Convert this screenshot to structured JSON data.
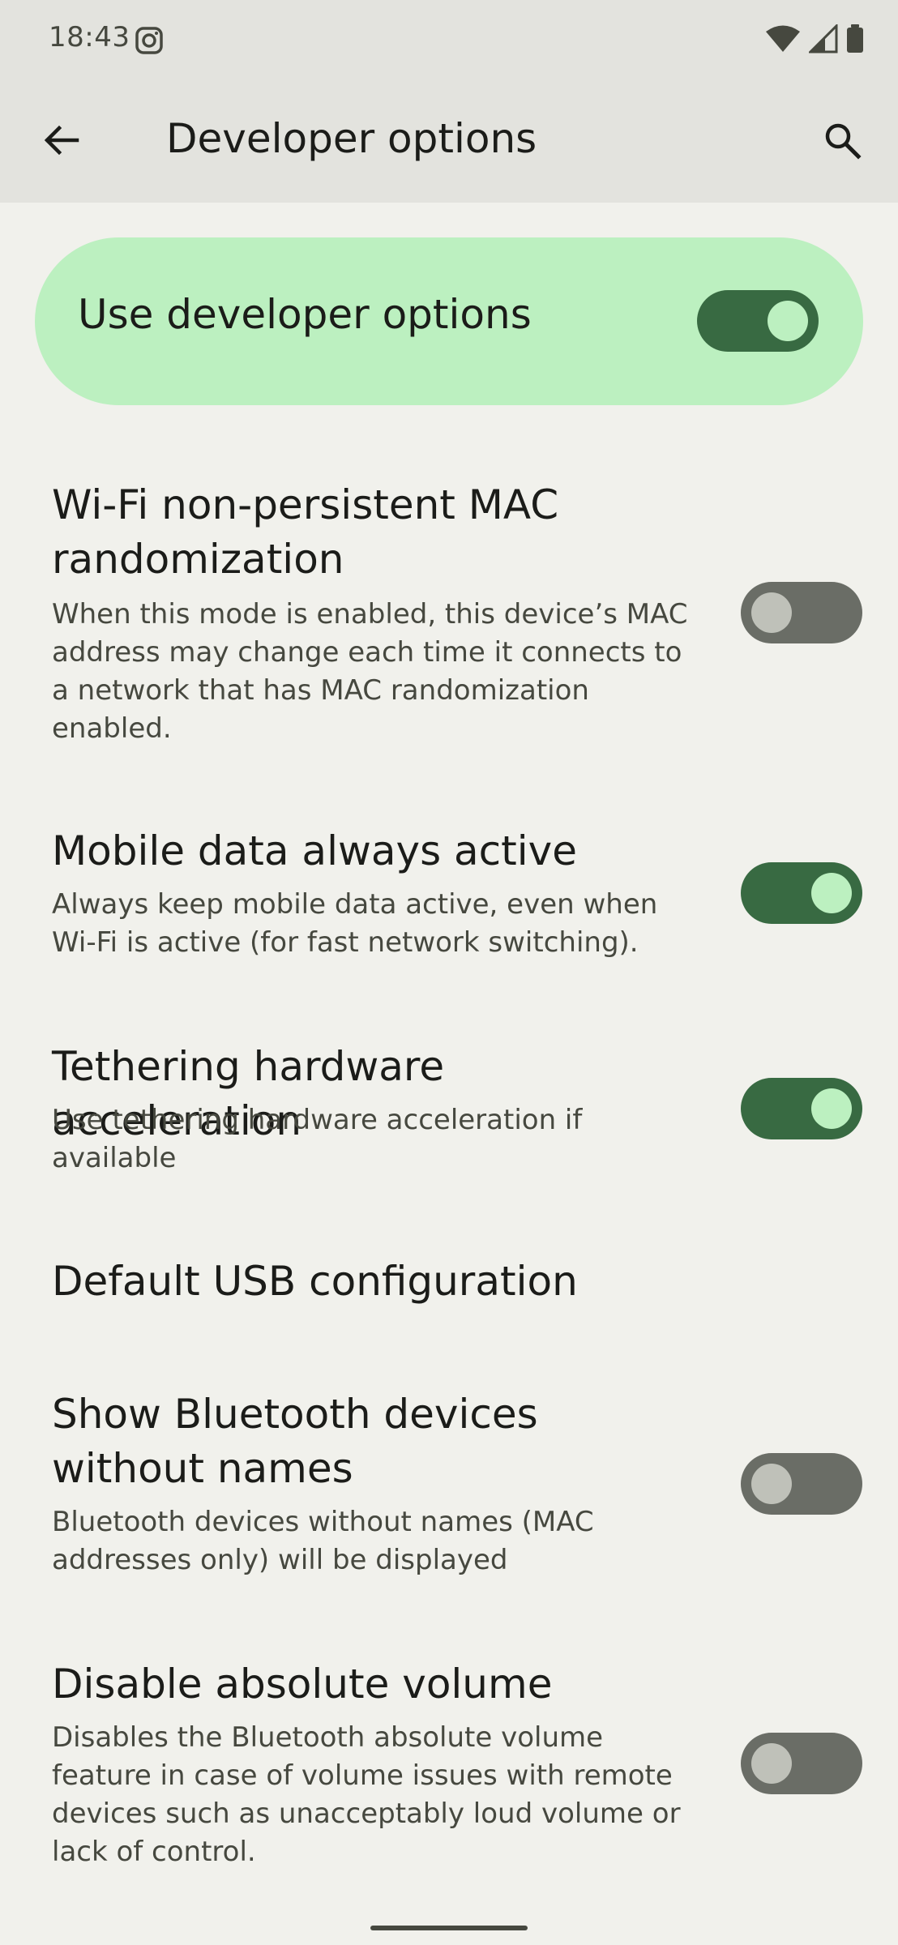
{
  "status_bar": {
    "time": "18:43"
  },
  "app_bar": {
    "title": "Developer options",
    "back_icon": "arrow-back-icon",
    "search_icon": "search-icon"
  },
  "master_switch": {
    "label": "Use developer options",
    "on": true
  },
  "settings": [
    {
      "title": "Wi-Fi non-persistent MAC randomization",
      "summary": "When this mode is enabled, this device’s MAC address may change each time it connects to a network that has MAC randomization enabled.",
      "on": false
    },
    {
      "title": "Mobile data always active",
      "summary": "Always keep mobile data active, even when Wi-Fi is active (for fast network switching).",
      "on": true
    },
    {
      "title": "Tethering hardware acceleration",
      "summary": "Use tethering hardware acceleration if available",
      "on": true
    },
    {
      "title": "Default USB configuration"
    },
    {
      "title": "Show Bluetooth devices without names",
      "summary": "Bluetooth devices without names (MAC addresses only) will be displayed",
      "on": false
    },
    {
      "title": "Disable absolute volume",
      "summary": "Disables the Bluetooth absolute volume feature in case of volume issues with remote devices such as unacceptably loud volume or lack of control.",
      "on": false
    }
  ],
  "colors": {
    "accent_dark": "#386a42",
    "accent_light": "#bcf0c0",
    "background": "#f1f1ec",
    "top_bar": "#e3e3de"
  }
}
